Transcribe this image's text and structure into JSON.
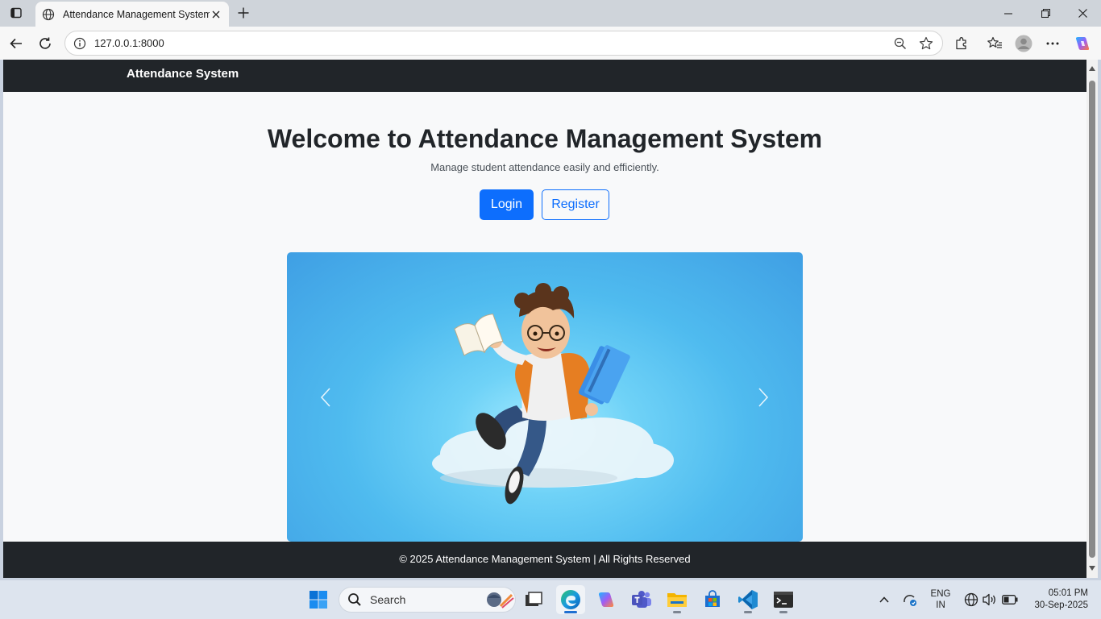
{
  "browser": {
    "tab": {
      "title": "Attendance Management System"
    },
    "address_bar": {
      "url": "127.0.0.1:8000"
    }
  },
  "page": {
    "navbar": {
      "brand": "Attendance System"
    },
    "hero": {
      "title": "Welcome to Attendance Management System",
      "subtitle": "Manage student attendance easily and efficiently.",
      "login_label": "Login",
      "register_label": "Register"
    },
    "footer": {
      "text": "© 2025 Attendance Management System | All Rights Reserved"
    }
  },
  "taskbar": {
    "search_label": "Search",
    "language": {
      "line1": "ENG",
      "line2": "IN"
    },
    "clock": {
      "time": "05:01 PM",
      "date": "30-Sep-2025"
    }
  },
  "colors": {
    "navbar_bg": "#212529",
    "primary": "#0d6efd",
    "page_bg": "#f8f9fa"
  },
  "icons": [
    "tab-actions-icon",
    "globe-icon",
    "close-icon",
    "plus-icon",
    "minimize-icon",
    "maximize-icon",
    "back-arrow-icon",
    "reload-icon",
    "info-icon",
    "zoom-out-icon",
    "star-icon",
    "extensions-icon",
    "favorites-icon",
    "profile-icon",
    "more-icon",
    "copilot-icon",
    "chevron-left-icon",
    "chevron-right-icon",
    "windows-start-icon",
    "search-icon",
    "task-view-icon",
    "edge-icon",
    "copilot-app-icon",
    "teams-icon",
    "file-explorer-icon",
    "store-icon",
    "vscode-icon",
    "terminal-icon",
    "chevron-up-icon",
    "network-icon",
    "sound-icon",
    "battery-icon"
  ]
}
